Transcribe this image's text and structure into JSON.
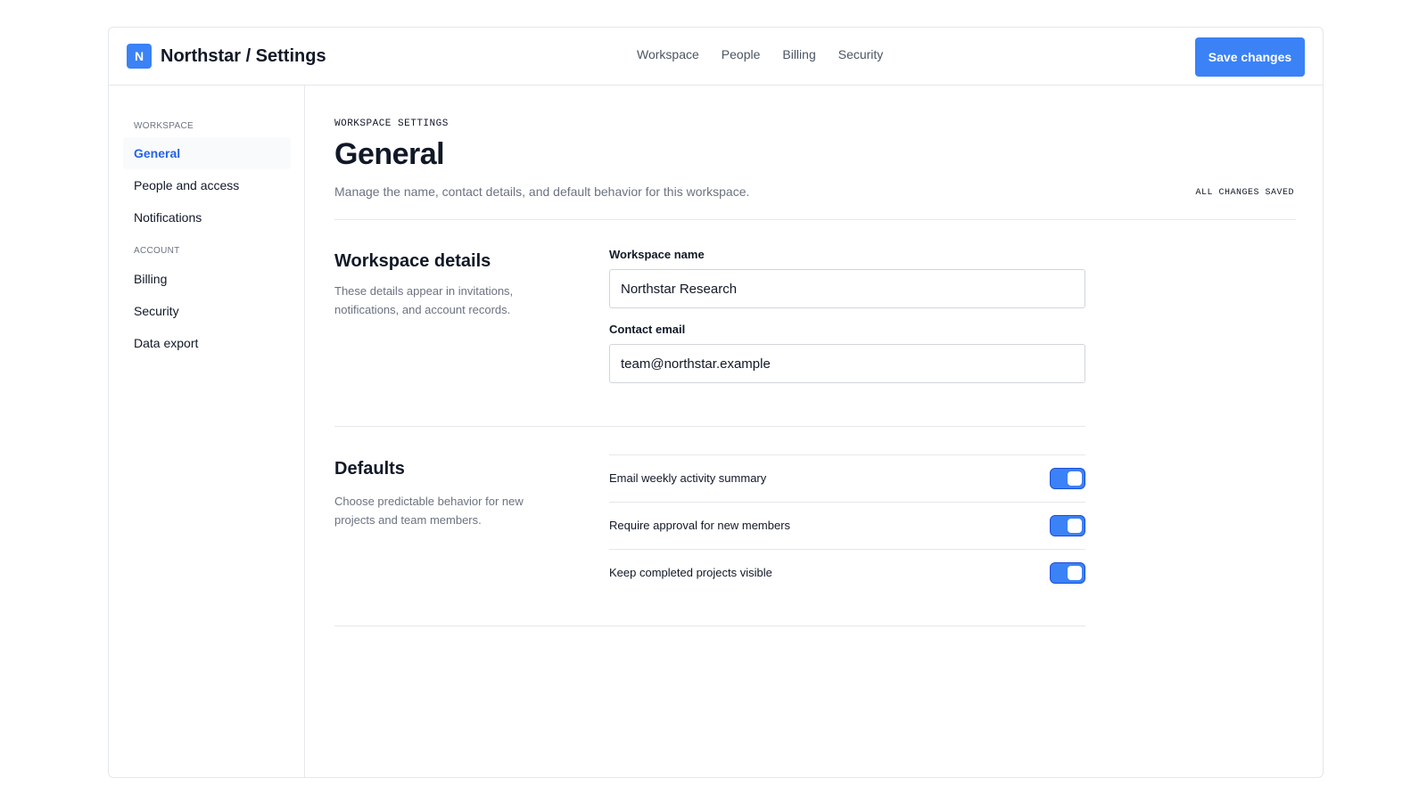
{
  "brand": {
    "logo_letter": "N",
    "title": "Northstar / Settings",
    "accent": "#3b82f6"
  },
  "topnav": {
    "items": [
      "Workspace",
      "People",
      "Billing",
      "Security"
    ]
  },
  "toolbar": {
    "save_label": "Save changes"
  },
  "sidebar": {
    "sections": [
      {
        "label": "WORKSPACE",
        "items": [
          {
            "label": "General",
            "active": true
          },
          {
            "label": "People and access",
            "active": false
          },
          {
            "label": "Notifications",
            "active": false
          }
        ]
      },
      {
        "label": "ACCOUNT",
        "items": [
          {
            "label": "Billing",
            "active": false
          },
          {
            "label": "Security",
            "active": false
          },
          {
            "label": "Data export",
            "active": false
          }
        ]
      }
    ]
  },
  "main": {
    "eyebrow": "WORKSPACE SETTINGS",
    "title": "General",
    "description": "Manage the name, contact details, and default behavior for this workspace.",
    "save_status": "ALL CHANGES SAVED",
    "details": {
      "title": "Workspace details",
      "description": "These details appear in invitations, notifications, and account records.",
      "fields": [
        {
          "label": "Workspace name",
          "value": "Northstar Research"
        },
        {
          "label": "Contact email",
          "value": "team@northstar.example"
        }
      ]
    },
    "defaults": {
      "title": "Defaults",
      "description": "Choose predictable behavior for new projects and team members.",
      "toggles": [
        {
          "label": "Email weekly activity summary",
          "on": true
        },
        {
          "label": "Require approval for new members",
          "on": true
        },
        {
          "label": "Keep completed projects visible",
          "on": true
        }
      ]
    }
  }
}
